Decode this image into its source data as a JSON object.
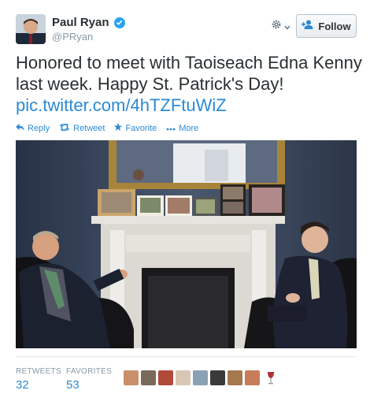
{
  "user": {
    "name": "Paul Ryan",
    "handle": "@PRyan"
  },
  "follow_label": "Follow",
  "tweet": {
    "text": "Honored to meet with Taoiseach Edna Kenny last week. Happy St. Patrick's Day!",
    "link": "pic.twitter.com/4hTZFtuWiZ"
  },
  "actions": {
    "reply": "Reply",
    "retweet": "Retweet",
    "favorite": "Favorite",
    "more": "More"
  },
  "stats": {
    "retweets_label": "RETWEETS",
    "retweets_count": "32",
    "favorites_label": "FAVORITES",
    "favorites_count": "53"
  },
  "icons": [
    "verified-icon",
    "gear-icon",
    "follow-person-icon",
    "reply-icon",
    "retweet-icon",
    "star-icon",
    "more-dots-icon",
    "wine-glass-icon"
  ],
  "colors": {
    "link": "#2a8ad6",
    "verified": "#2aa3ef",
    "muted": "#8899a6",
    "text": "#292f33"
  }
}
